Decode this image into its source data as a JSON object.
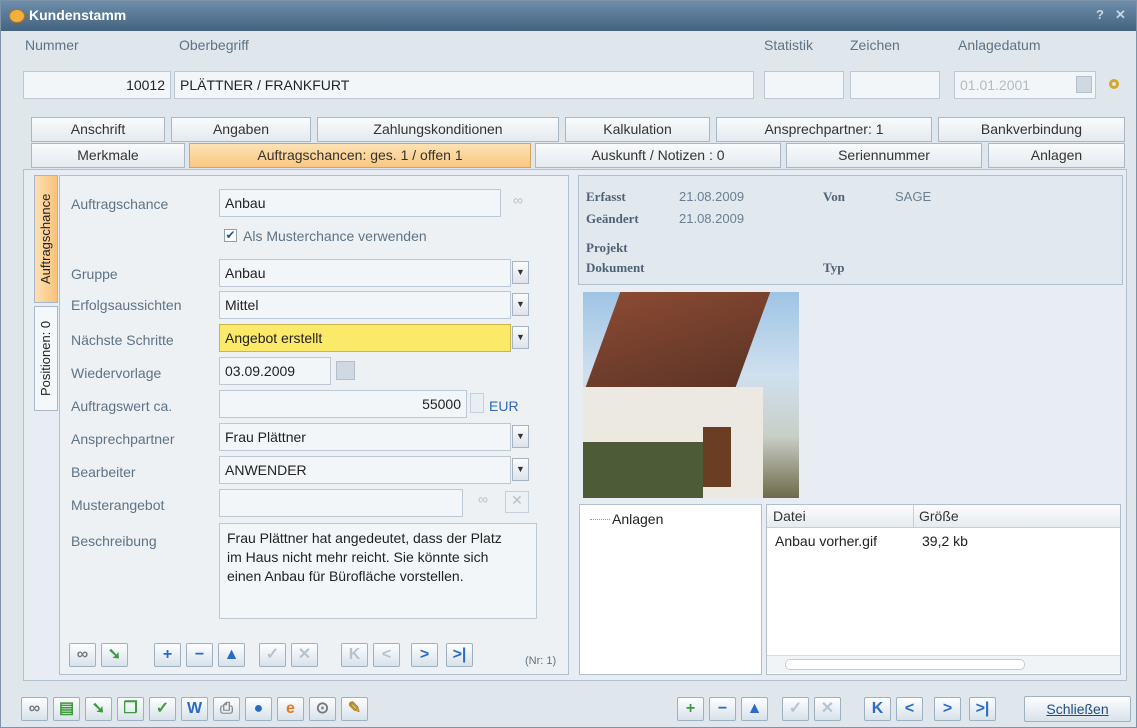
{
  "window": {
    "title": "Kundenstamm",
    "help": "?",
    "close": "✕"
  },
  "header": {
    "nummer_label": "Nummer",
    "nummer": "10012",
    "oberbegriff_label": "Oberbegriff",
    "oberbegriff": "PLÄTTNER / FRANKFURT",
    "statistik_label": "Statistik",
    "zeichen_label": "Zeichen",
    "anlagedatum_label": "Anlagedatum",
    "anlagedatum": "01.01.2001"
  },
  "tabs_row1": [
    "Anschrift",
    "Angaben",
    "Zahlungskonditionen",
    "Kalkulation",
    "Ansprechpartner: 1",
    "Bankverbindung"
  ],
  "tabs_row2": [
    "Merkmale",
    "Auftragschancen: ges. 1 / offen 1",
    "Auskunft / Notizen : 0",
    "Seriennummer",
    "Anlagen"
  ],
  "side_tabs": [
    "Auftragschance",
    "Positionen: 0"
  ],
  "form": {
    "auftragschance_label": "Auftragschance",
    "auftragschance": "Anbau",
    "muster_label": "Als Musterchance verwenden",
    "gruppe_label": "Gruppe",
    "gruppe": "Anbau",
    "erfolg_label": "Erfolgsaussichten",
    "erfolg": "Mittel",
    "schritte_label": "Nächste Schritte",
    "schritte": "Angebot erstellt",
    "wiedervorlage_label": "Wiedervorlage",
    "wiedervorlage": "03.09.2009",
    "wert_label": "Auftragswert ca.",
    "wert": "55000",
    "waehrung": "EUR",
    "ansprech_label": "Ansprechpartner",
    "ansprech": "Frau Plättner",
    "bearbeiter_label": "Bearbeiter",
    "bearbeiter": "ANWENDER",
    "musterangebot_label": "Musterangebot",
    "beschreibung_label": "Beschreibung",
    "beschreibung": "Frau Plättner hat angedeutet, dass der Platz im Haus nicht mehr reicht. Sie könnte sich einen Anbau für Bürofläche vorstellen.",
    "record_no": "(Nr: 1)"
  },
  "info": {
    "erfasst_label": "Erfasst",
    "erfasst": "21.08.2009",
    "von_label": "Von",
    "von": "SAGE",
    "geaendert_label": "Geändert",
    "geaendert": "21.08.2009",
    "projekt_label": "Projekt",
    "dokument_label": "Dokument",
    "typ_label": "Typ"
  },
  "anlagen": {
    "tree_label": "Anlagen",
    "columns": [
      "Datei",
      "Größe"
    ],
    "rows": [
      {
        "datei": "Anbau vorher.gif",
        "groesse": "39,2 kb"
      }
    ]
  },
  "footer": {
    "close_label": "Schließen"
  }
}
